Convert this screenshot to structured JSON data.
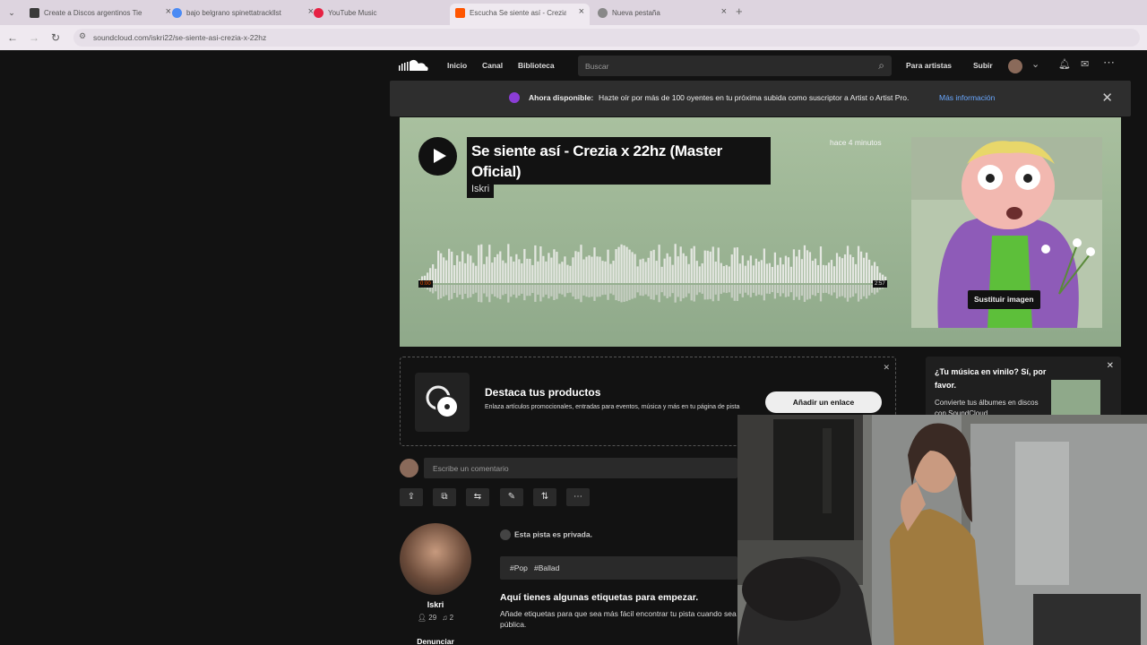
{
  "browser": {
    "tabs": [
      {
        "title": "Create a Discos argentinos Tie",
        "favicon_color": "#3a3a3a",
        "active": false
      },
      {
        "title": "bajo belgrano spinettatrackllst",
        "favicon_color": "#4a8af4",
        "active": false
      },
      {
        "title": "YouTube Music",
        "favicon_color": "#e62143",
        "active": false
      },
      {
        "title": "Escucha Se siente así - Crezia x",
        "favicon_color": "#ff5500",
        "active": true
      },
      {
        "title": "Nueva pestaña",
        "favicon_color": "#888888",
        "active": false
      }
    ],
    "address": "soundcloud.com/iskri22/se-siente-asi-crezia-x-22hz"
  },
  "header": {
    "nav": [
      "Inicio",
      "Canal",
      "Biblioteca"
    ],
    "search_placeholder": "Buscar",
    "for_artists": "Para artistas",
    "upload": "Subir"
  },
  "banner": {
    "bold": "Ahora disponible:",
    "text": "Hazte oír por más de 100 oyentes en tu próxima subida como suscriptor a Artist o Artist Pro.",
    "link": "Más información"
  },
  "track": {
    "title": "Se siente así - Crezia x 22hz (Master Oficial)",
    "artist": "Iskri",
    "time_ago": "hace 4 minutos",
    "position": "0:00",
    "duration": "2:57",
    "progress": 0.0,
    "replace_image": "Sustituir imagen"
  },
  "promo": {
    "title": "Destaca tus productos",
    "desc": "Enlaza artículos promocionales, entradas para eventos, música y más en tu página de pista",
    "button": "Añadir un enlace"
  },
  "vinyl": {
    "title": "¿Tu música en vinilo? Sí, por favor.",
    "desc": "Convierte tus álbumes en discos con SoundCloud"
  },
  "comment": {
    "placeholder": "Escribe un comentario"
  },
  "user": {
    "name": "Iskri",
    "followers": "29",
    "tracks": "2",
    "report": "Denunciar"
  },
  "details": {
    "private": "Esta pista es privada.",
    "tags": [
      "#Pop",
      "#Ballad"
    ],
    "tags_heading": "Aquí tienes algunas etiquetas para empezar.",
    "tags_desc": "Añade etiquetas para que sea más fácil encontrar tu pista cuando sea pública."
  },
  "colors": {
    "accent": "#ff5500",
    "hero_bg": "#a9c09f",
    "page_bg": "#121212"
  }
}
